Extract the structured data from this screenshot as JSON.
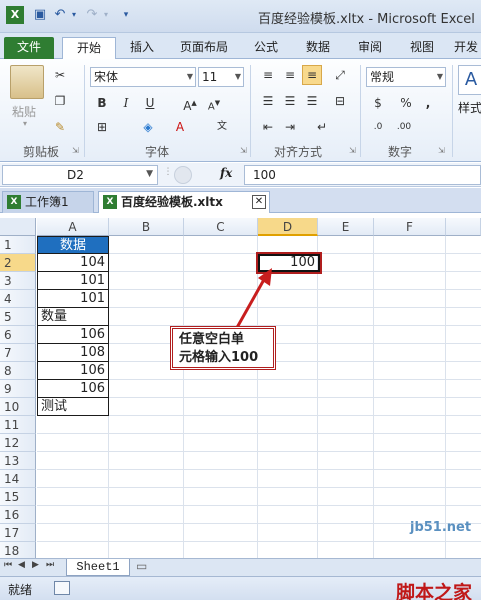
{
  "window": {
    "title": "百度经验模板.xltx - Microsoft Excel"
  },
  "ribbon_tabs": [
    "文件",
    "开始",
    "插入",
    "页面布局",
    "公式",
    "数据",
    "审阅",
    "视图",
    "开发"
  ],
  "ribbon": {
    "paste_label": "粘贴",
    "font_name": "宋体",
    "font_size": "11",
    "number_format": "常规",
    "groups": {
      "clipboard": "剪贴板",
      "font": "字体",
      "alignment": "对齐方式",
      "number": "数字"
    },
    "styles_partial": "样式"
  },
  "formula_bar": {
    "name_box": "D2",
    "fx": "fx",
    "value": "100"
  },
  "doc_tabs": [
    {
      "label": "工作簿1"
    },
    {
      "label": "百度经验模板.xltx"
    }
  ],
  "columns": [
    "A",
    "B",
    "C",
    "D",
    "E",
    "F"
  ],
  "rows": [
    "1",
    "2",
    "3",
    "4",
    "5",
    "6",
    "7",
    "8",
    "9",
    "10",
    "11",
    "12",
    "13",
    "14",
    "15",
    "16",
    "17",
    "18"
  ],
  "cells": {
    "A1": "数据",
    "A2": "104",
    "A3": "101",
    "A4": "101",
    "A5": "数量",
    "A6": "106",
    "A7": "108",
    "A8": "106",
    "A9": "106",
    "A10": "测试",
    "D2": "100"
  },
  "annotation": {
    "line1": "任意空白单",
    "line2": "元格输入100"
  },
  "sheet_tabs": [
    "Sheet1"
  ],
  "status": {
    "ready": "就绪"
  },
  "watermark": {
    "site": "jb51.net",
    "brand": "脚本之家"
  },
  "colors": {
    "header_fill": "#1f6fbf",
    "annotation_border": "#b01e1e",
    "file_tab": "#2f7d32",
    "selected_col_header": "#f7d98a"
  }
}
